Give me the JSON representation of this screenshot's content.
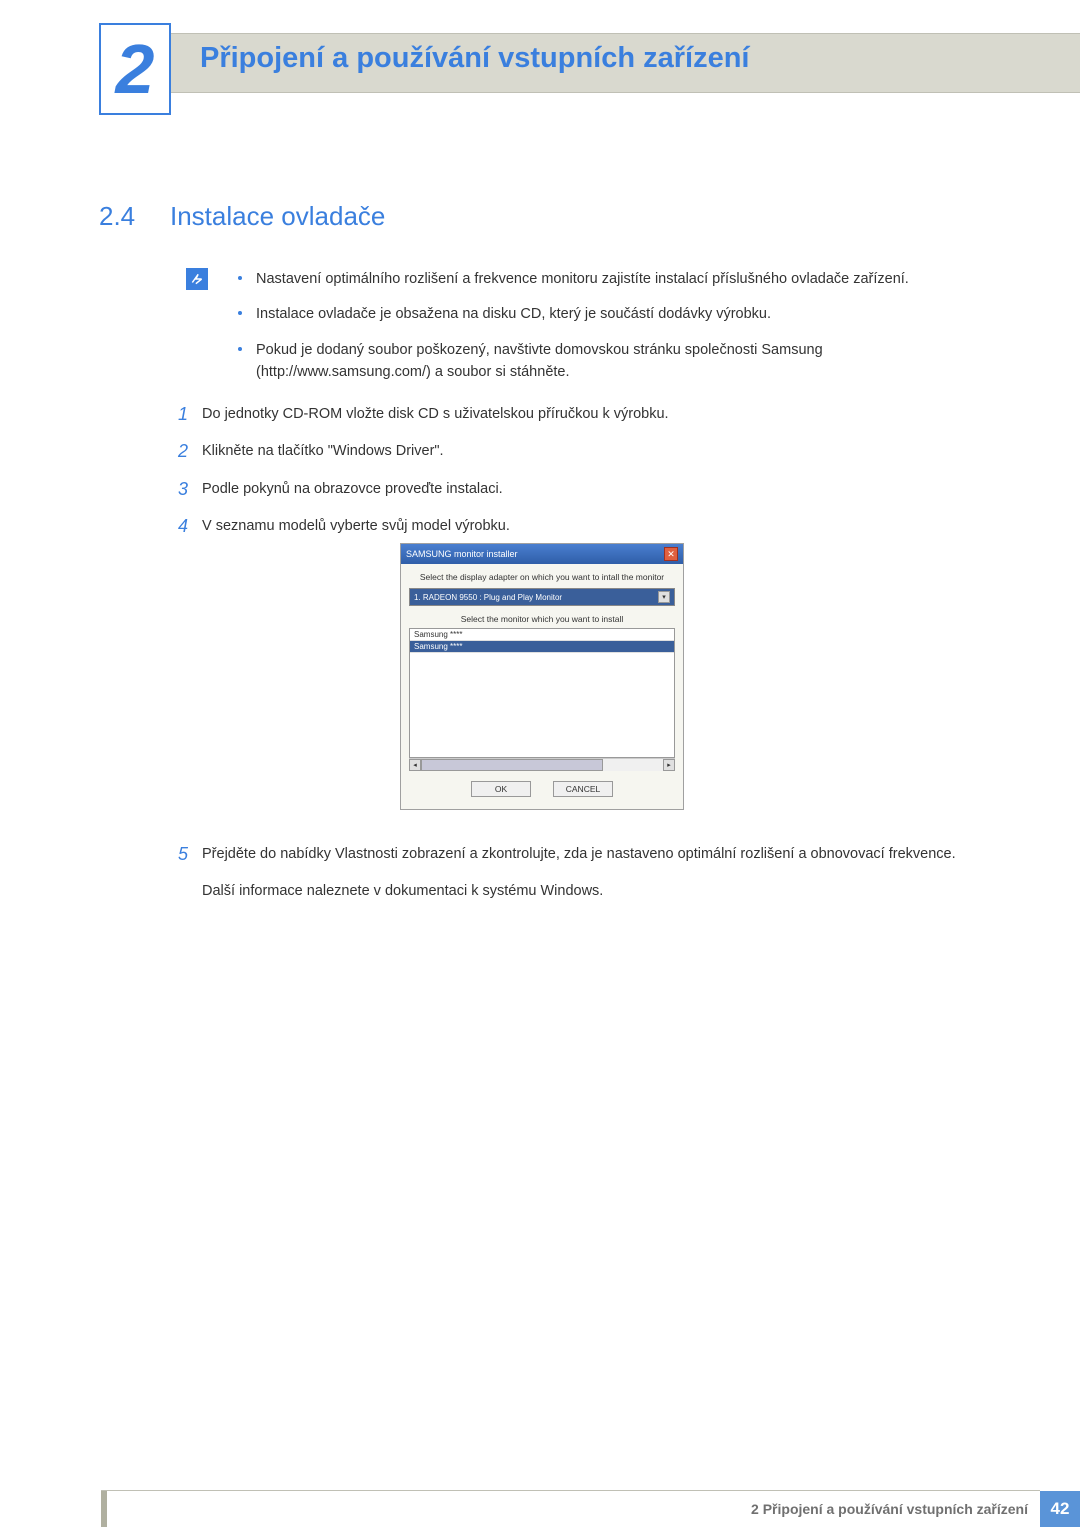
{
  "header": {
    "chapter_number": "2",
    "chapter_title": "Připojení a používání vstupních zařízení"
  },
  "section": {
    "number": "2.4",
    "title": "Instalace ovladače"
  },
  "notes": [
    "Nastavení optimálního rozlišení a frekvence monitoru zajistíte instalací příslušného ovladače zařízení.",
    "Instalace ovladače je obsažena na disku CD, který je součástí dodávky výrobku.",
    "Pokud je dodaný soubor poškozený, navštivte domovskou stránku společnosti Samsung (http://www.samsung.com/) a soubor si stáhněte."
  ],
  "steps": {
    "s1": "Do jednotky CD-ROM vložte disk CD s uživatelskou příručkou k výrobku.",
    "s2": "Klikněte na tlačítko \"Windows Driver\".",
    "s3": "Podle pokynů na obrazovce proveďte instalaci.",
    "s4": "V seznamu modelů vyberte svůj model výrobku.",
    "s5a": "Přejděte do nabídky Vlastnosti zobrazení a zkontrolujte, zda je nastaveno optimální rozlišení a obnovovací frekvence.",
    "s5b": "Další informace naleznete v dokumentaci k systému Windows."
  },
  "dialog": {
    "title": "SAMSUNG monitor installer",
    "label_adapter": "Select the display adapter on which you want to intall the monitor",
    "adapter_value": "1. RADEON 9550 : Plug and Play Monitor",
    "label_monitor": "Select the monitor which you want to install",
    "monitor_items": [
      "Samsung ****",
      "Samsung ****"
    ],
    "ok": "OK",
    "cancel": "CANCEL"
  },
  "footer": {
    "text": "2 Připojení a používání vstupních zařízení",
    "page": "42"
  }
}
